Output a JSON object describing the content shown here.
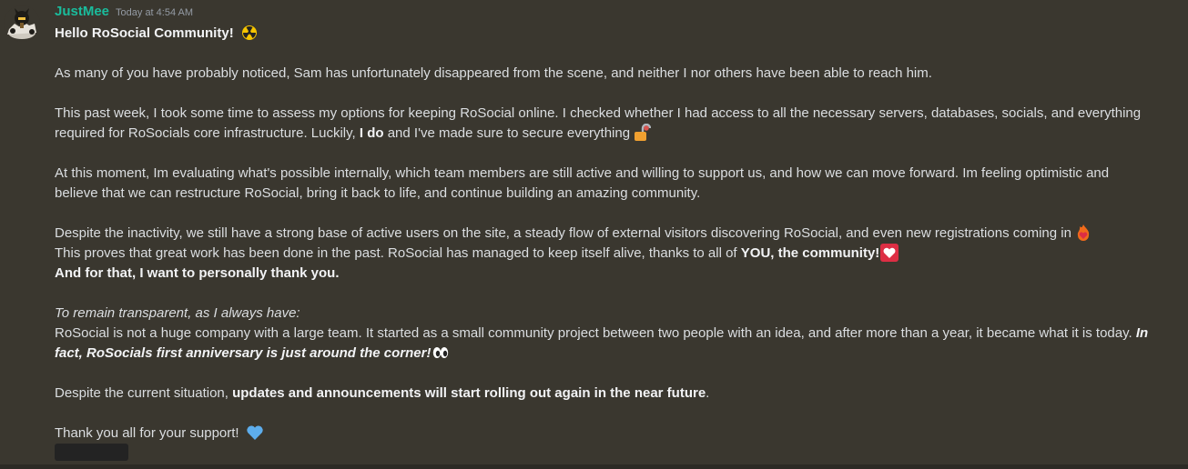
{
  "message": {
    "author": "JustMee",
    "timestamp": "Today at 4:54 AM",
    "greeting": "Hello RoSocial Community!",
    "p1": "As many of you have probably noticed, Sam has unfortunately disappeared from the scene, and neither I nor others have been able to reach him.",
    "p2_line1": "This past week, I took some time to assess my options for keeping RoSocial online. I checked whether I had access to all the necessary servers, databases, socials, and everything",
    "p2_line2_a": "required for RoSocials core infrastructure. Luckily,",
    "p2_line2_bold": "I do",
    "p2_line2_b": "and I've made sure to secure everything",
    "p3_line1": "At this moment, Im evaluating what's possible internally, which team members are still active and willing to support us, and how we can move forward. Im feeling optimistic and",
    "p3_line2": "believe that we can restructure RoSocial, bring it back to life, and continue building an amazing community.",
    "p4_line1": "Despite the inactivity, we still have a strong base of active users on the site, a steady flow of external visitors discovering RoSocial, and even new registrations coming in",
    "p4_line2_a": "This proves that great work has been done in the past. RoSocial has managed to keep itself alive, thanks to all of",
    "p4_line2_bold": "YOU, the community!",
    "p4_line3_bold": "And for that, I want to personally thank you.",
    "p5_italic": "To remain transparent, as I always have:",
    "p5_line2_a": "RoSocial is not a huge company with a large team. It started as a small community project between two people with an idea, and after more than a year, it became what it is today.",
    "p5_line2_bi": "In",
    "p5_line3_bi": "fact, RoSocials first anniversary is just around the corner!",
    "p6_a": "Despite the current situation,",
    "p6_bold": "updates and announcements will start rolling out again in the near future",
    "p6_end": ".",
    "p7": "Thank you all for your support!"
  },
  "icons": {
    "greeting_emoji": "radioactive-emoji",
    "lock_emoji": "unlocked-lock-emoji",
    "fire_emoji": "fire-heart-emoji",
    "heart_emoji": "heart-emoji",
    "eyes_emoji": "eyes-emoji",
    "blue_heart_emoji": "blue-heart-emoji"
  },
  "colors": {
    "background": "#3a372f",
    "username": "#1abc9c",
    "text": "#dbdee1",
    "timestamp": "#949ba4"
  }
}
